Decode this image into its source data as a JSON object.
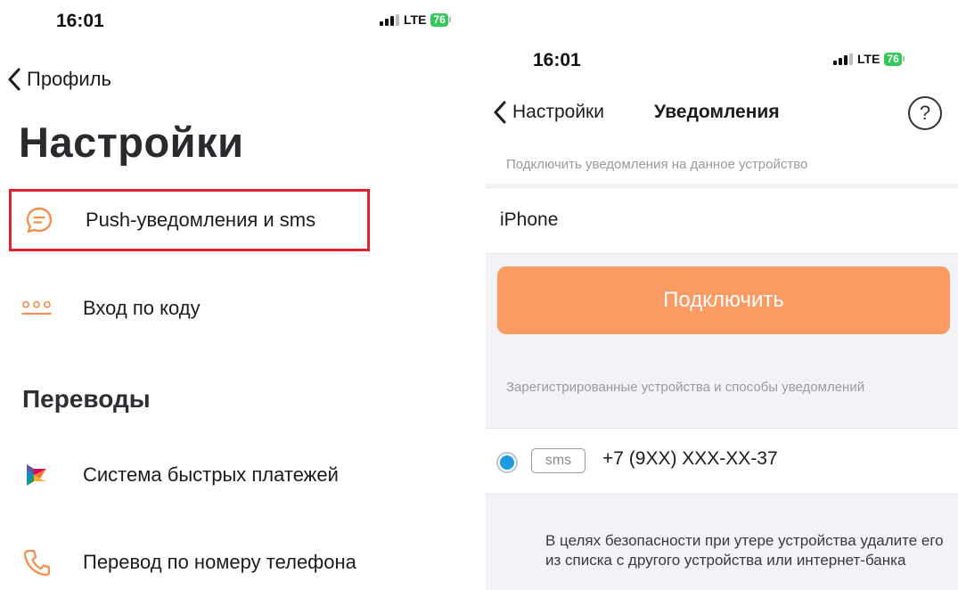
{
  "left_screen": {
    "status_bar": {
      "time": "16:01",
      "network": "LTE",
      "battery": "76"
    },
    "back_label": "Профиль",
    "title": "Настройки",
    "items": [
      {
        "label": "Push-уведомления и sms",
        "icon": "chat-bubble-icon",
        "highlighted": true
      },
      {
        "label": "Вход по коду",
        "icon": "passcode-dots-icon"
      }
    ],
    "section_transfers": "Переводы",
    "transfer_items": [
      {
        "label": "Система быстрых платежей",
        "icon": "sbp-logo-icon"
      },
      {
        "label": "Перевод по номеру телефона",
        "icon": "phone-icon"
      }
    ]
  },
  "right_screen": {
    "status_bar": {
      "time": "16:01",
      "network": "LTE",
      "battery": "76"
    },
    "back_label": "Настройки",
    "title": "Уведомления",
    "help_symbol": "?",
    "connect_caption": "Подключить уведомления на данное устройство",
    "device_name": "iPhone",
    "connect_button": "Подключить",
    "registered_caption": "Зарегистрированные устройства и способы уведомлений",
    "registered_devices": [
      {
        "type": "sms",
        "value": "+7 (9XX) XXX-XX-37",
        "selected": true
      }
    ],
    "security_note": "В целях безопасности при утере устройства удалите его из списка с другого устройства или интернет-банка"
  },
  "colors": {
    "accent_orange": "#f99b62",
    "highlight_red": "#e0232b",
    "radio_blue": "#1e9be0",
    "battery_green": "#34c759"
  }
}
